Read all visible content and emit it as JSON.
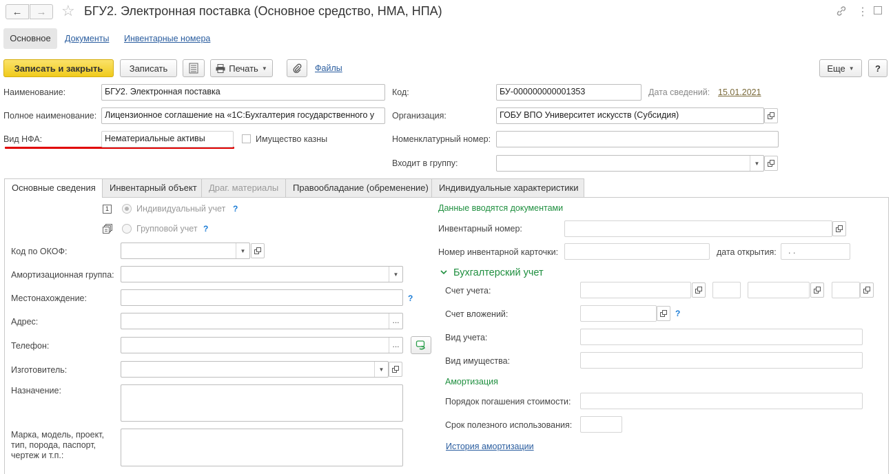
{
  "window": {
    "title": "БГУ2. Электронная поставка (Основное средство, НМА, НПА)"
  },
  "nav_tabs": [
    "Основное",
    "Документы",
    "Инвентарные номера"
  ],
  "toolbar": {
    "save_close": "Записать и закрыть",
    "save": "Записать",
    "print": "Печать",
    "files": "Файлы",
    "more": "Еще",
    "help": "?"
  },
  "header_form": {
    "name_label": "Наименование:",
    "name_value": "БГУ2. Электронная поставка",
    "fullname_label": "Полное наименование:",
    "fullname_value": "Лицензионное соглашение на «1С:Бухгалтерия государственного у",
    "nfa_label": "Вид НФА:",
    "nfa_value": "Нематериальные активы",
    "treasury_label": "Имущество казны",
    "code_label": "Код:",
    "code_value": "БУ-000000000001353",
    "date_label": "Дата сведений:",
    "date_value": "15.01.2021",
    "org_label": "Организация:",
    "org_value": "ГОБУ ВПО Университет искусств (Субсидия)",
    "nomen_label": "Номенклатурный номер:",
    "group_label": "Входит в группу:"
  },
  "content_tabs": [
    "Основные сведения",
    "Инвентарный объект",
    "Драг. материалы",
    "Правообладание (обременение)",
    "Индивидуальные характеристики"
  ],
  "left": {
    "individual": "Индивидуальный учет",
    "group": "Групповой учет",
    "okof": "Код по ОКОФ:",
    "amort_group": "Амортизационная группа:",
    "location": "Местонахождение:",
    "address": "Адрес:",
    "phone": "Телефон:",
    "maker": "Изготовитель:",
    "purpose": "Назначение:",
    "brand": "Марка, модель, проект, тип, порода, паспорт, чертеж и т.п.:"
  },
  "right": {
    "heading": "Данные вводятся документами",
    "inv_number": "Инвентарный номер:",
    "card_number": "Номер инвентарной карточки:",
    "open_date": "дата открытия:",
    "open_date_value": ". .",
    "accounting": "Бухгалтерский учет",
    "account": "Счет учета:",
    "invest_account": "Счет вложений:",
    "accounting_type": "Вид учета:",
    "property_type": "Вид имущества:",
    "amortization": "Амортизация",
    "repayment": "Порядок погашения стоимости:",
    "useful_life": "Срок полезного использования:",
    "history": "История амортизации"
  },
  "colors": {
    "accent_button": "#f5d328",
    "underline": "#e00000",
    "green_heading": "#1f8f3f",
    "link": "#2a5d9f"
  }
}
